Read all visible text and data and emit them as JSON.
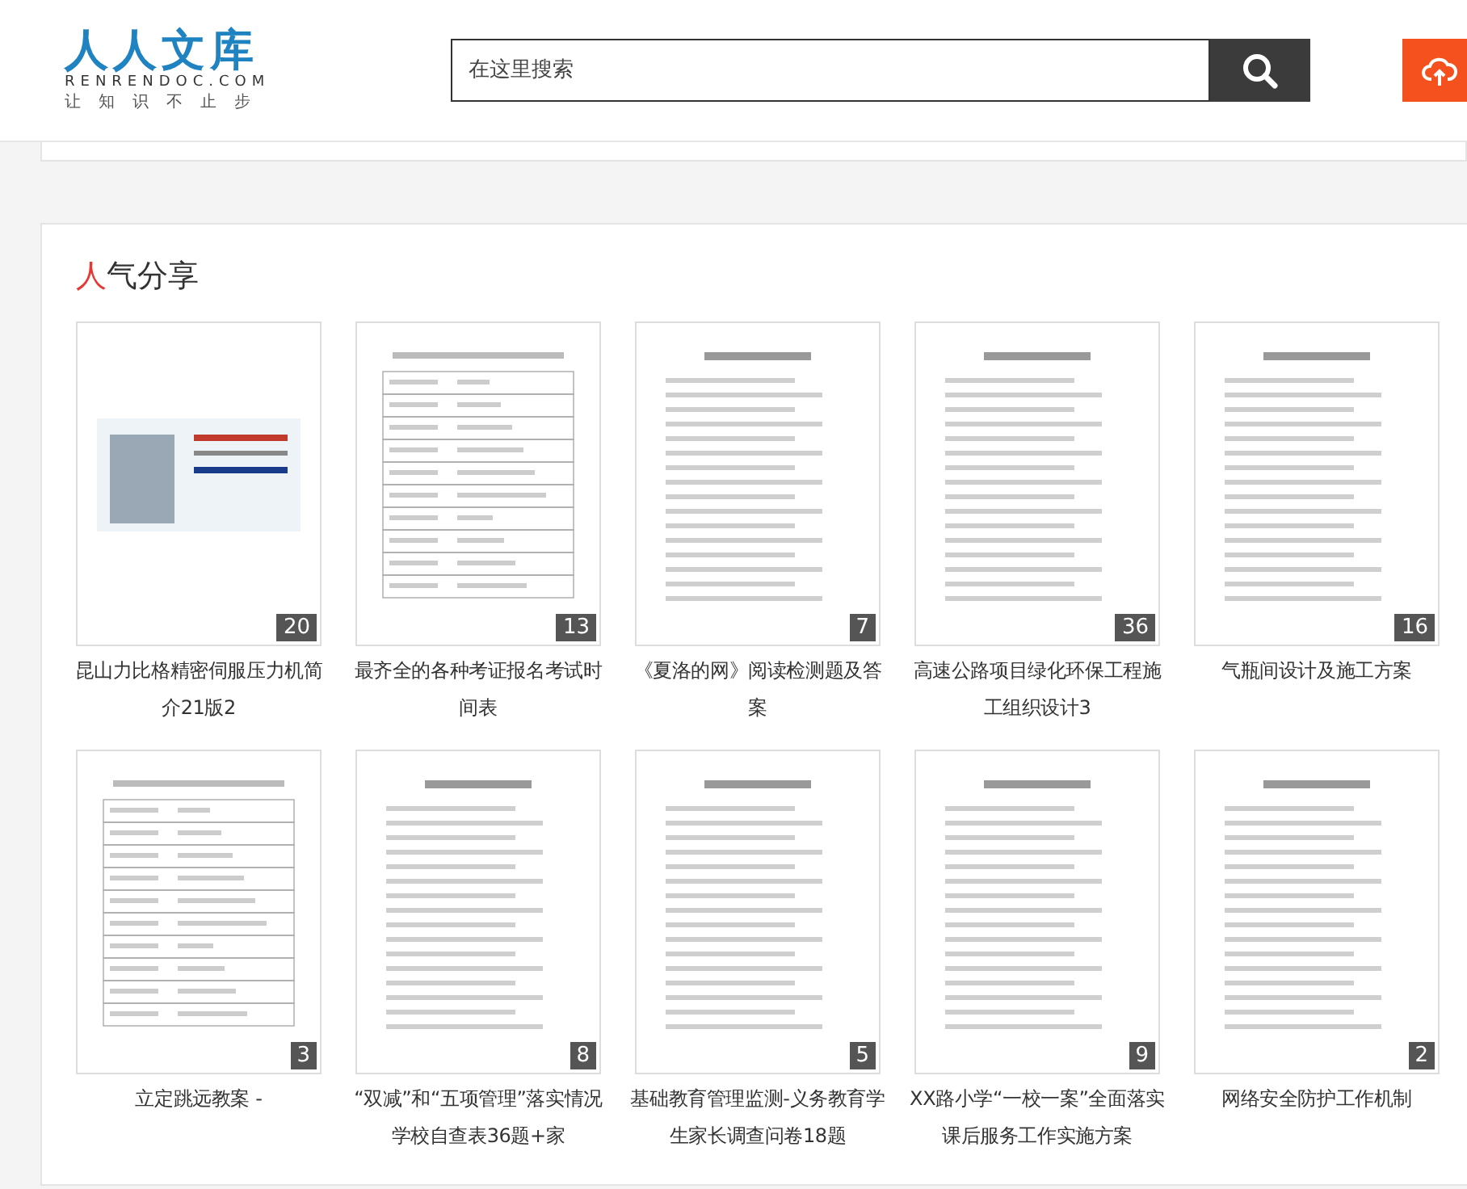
{
  "logo": {
    "title": "人人文库",
    "domain": "RENRENDOC.COM",
    "slogan": "让知识不止步"
  },
  "search": {
    "placeholder": "在这里搜索"
  },
  "section": {
    "title_accent": "人",
    "title_rest": "气分享"
  },
  "documents": [
    {
      "title": "昆山力比格精密伺服压力机简介21版2",
      "pages": "20",
      "kind": "photo"
    },
    {
      "title": "最齐全的各种考证报名考试时间表",
      "pages": "13",
      "kind": "table"
    },
    {
      "title": "《夏洛的网》阅读检测题及答案",
      "pages": "7",
      "kind": "text"
    },
    {
      "title": "高速公路项目绿化环保工程施工组织设计3",
      "pages": "36",
      "kind": "text"
    },
    {
      "title": "气瓶间设计及施工方案",
      "pages": "16",
      "kind": "text"
    },
    {
      "title": "立定跳远教案 -",
      "pages": "3",
      "kind": "table"
    },
    {
      "title": "“双减”和“五项管理”落实情况学校自查表36题+家",
      "pages": "8",
      "kind": "text"
    },
    {
      "title": "基础教育管理监测-义务教育学生家长调查问卷18题",
      "pages": "5",
      "kind": "text"
    },
    {
      "title": "XX路小学“一校一案”全面落实课后服务工作实施方案",
      "pages": "9",
      "kind": "text"
    },
    {
      "title": "网络安全防护工作机制",
      "pages": "2",
      "kind": "text"
    }
  ]
}
